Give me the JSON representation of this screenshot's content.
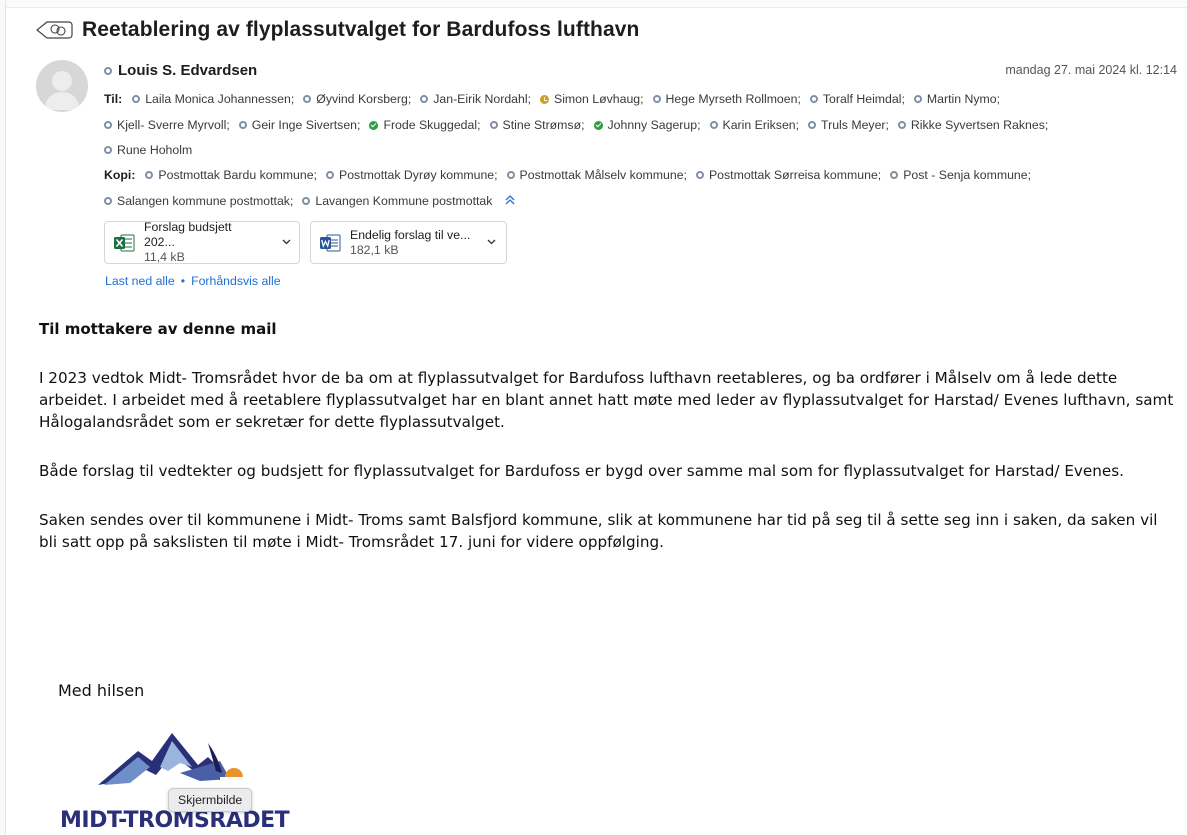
{
  "message": {
    "subject": "Reetablering av flyplassutvalget for Bardufoss lufthavn",
    "sender": {
      "name": "Louis S. Edvardsen",
      "status": "offline"
    },
    "date": "mandag 27. mai 2024 kl. 12:14"
  },
  "recipients": {
    "to_label": "Til:",
    "to": [
      {
        "name": "Laila Monica Johannessen;",
        "status": "offline"
      },
      {
        "name": "Øyvind Korsberg;",
        "status": "offline"
      },
      {
        "name": "Jan-Eirik Nordahl;",
        "status": "offline"
      },
      {
        "name": "Simon Løvhaug;",
        "status": "away"
      },
      {
        "name": "Hege Myrseth Rollmoen;",
        "status": "offline"
      },
      {
        "name": "Toralf Heimdal;",
        "status": "offline"
      },
      {
        "name": "Martin Nymo;",
        "status": "offline"
      },
      {
        "name": "Kjell- Sverre Myrvoll;",
        "status": "offline"
      },
      {
        "name": "Geir Inge Sivertsen;",
        "status": "offline"
      },
      {
        "name": "Frode Skuggedal;",
        "status": "available"
      },
      {
        "name": "Stine Strømsø;",
        "status": "offline"
      },
      {
        "name": "Johnny Sagerup;",
        "status": "available"
      },
      {
        "name": "Karin  Eriksen;",
        "status": "offline"
      },
      {
        "name": "Truls Meyer;",
        "status": "offline"
      },
      {
        "name": "Rikke Syvertsen Raknes;",
        "status": "offline"
      },
      {
        "name": "Rune Hoholm",
        "status": "offline"
      }
    ],
    "cc_label": "Kopi:",
    "cc": [
      {
        "name": "Postmottak Bardu kommune;",
        "status": "offline"
      },
      {
        "name": "Postmottak Dyrøy kommune;",
        "status": "offline"
      },
      {
        "name": "Postmottak Målselv kommune;",
        "status": "offline"
      },
      {
        "name": "Postmottak Sørreisa kommune;",
        "status": "offline"
      },
      {
        "name": "Post - Senja kommune;",
        "status": "offline"
      },
      {
        "name": "Salangen kommune postmottak;",
        "status": "offline"
      },
      {
        "name": "Lavangen Kommune postmottak",
        "status": "offline"
      }
    ],
    "collapse_icon": "chevron-up-double-icon"
  },
  "attachments": [
    {
      "name": "Forslag budsjett 202...",
      "size": "11,4 kB",
      "icon": "excel-icon"
    },
    {
      "name": "Endelig forslag til ve...",
      "size": "182,1 kB",
      "icon": "word-icon"
    }
  ],
  "attachment_actions": {
    "download_all": "Last ned alle",
    "separator": "•",
    "preview_all": "Forhåndsvis alle"
  },
  "body": {
    "heading": "Til mottakere av denne mail",
    "paragraphs": [
      "I 2023 vedtok Midt- Tromsrådet hvor de ba om at flyplassutvalget for Bardufoss lufthavn reetableres, og ba ordfører i Målselv om å lede dette arbeidet. I arbeidet med å reetablere flyplassutvalget har en blant annet hatt møte med leder av flyplassutvalget for Harstad/ Evenes lufthavn, samt Hålogalandsrådet som er sekretær for dette flyplassutvalget.",
      "Både forslag til vedtekter og budsjett for flyplassutvalget for Bardufoss er bygd over samme mal som for flyplassutvalget for Harstad/ Evenes.",
      "Saken sendes over til kommunene i Midt- Troms samt Balsfjord kommune, slik at kommunene har tid på seg til å sette seg inn i saken, da saken vil bli satt opp på sakslisten til møte i Midt- Tromsrådet 17. juni for videre oppfølging."
    ],
    "greeting": "Med hilsen",
    "logo_text": "MIDT-TROMSRÅDET",
    "tooltip": "Skjermbilde"
  },
  "colors": {
    "link": "#1f6fd6",
    "available": "#2e9d43",
    "away": "#c9a227",
    "offline": "#7f8fa6",
    "logo_navy": "#2a2f7a",
    "logo_sun": "#e8922a"
  }
}
